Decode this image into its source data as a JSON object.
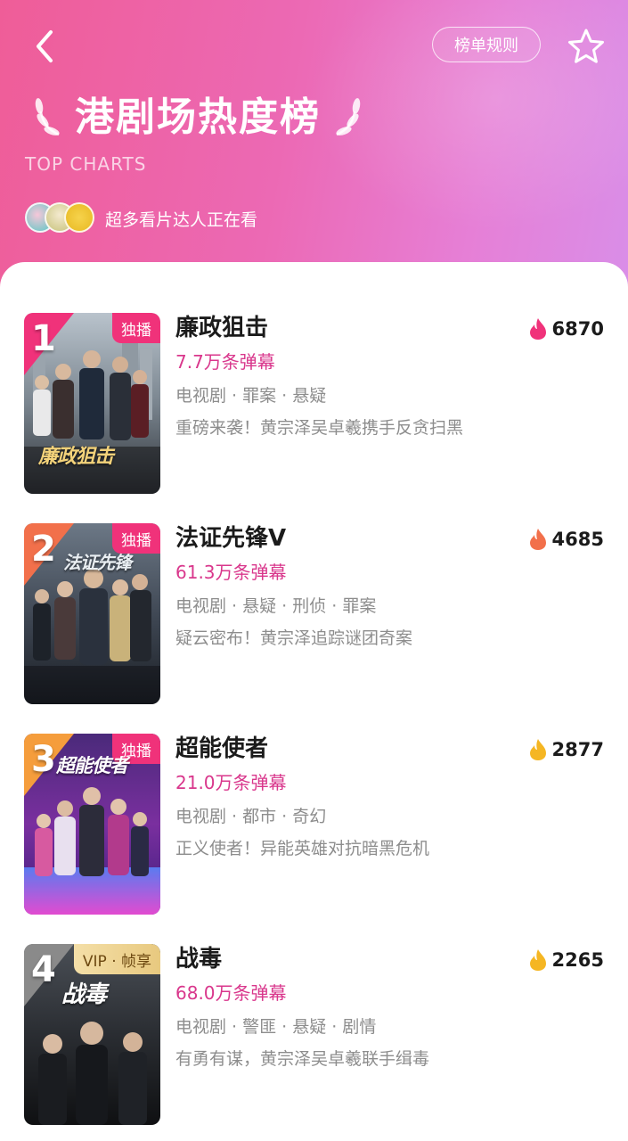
{
  "header": {
    "rules_label": "榜单规则",
    "title": "港剧场热度榜",
    "subtitle": "TOP CHARTS",
    "watching_text": "超多看片达人正在看"
  },
  "colors": {
    "header_gradient_start": "#ef5d98",
    "header_gradient_end": "#d98ee8",
    "danmu_text": "#d9378c",
    "exclusive_tag": "#f0327a",
    "rank1_badge": "#f0327a",
    "rank2_badge": "#f2704b",
    "rank3_badge": "#f59d3c",
    "rank4_badge": "#8a8a8a"
  },
  "items": [
    {
      "rank": "1",
      "tag": "独播",
      "tag_type": "exclusive",
      "poster_text": "廉政狙击",
      "title": "廉政狙击",
      "danmu": "7.7万条弹幕",
      "genres": "电视剧 · 罪案 · 悬疑",
      "desc": "重磅来袭！黄宗泽吴卓羲携手反贪扫黑",
      "heat": "6870",
      "flame_color": "#f0327a"
    },
    {
      "rank": "2",
      "tag": "独播",
      "tag_type": "exclusive",
      "poster_text": "法证先锋",
      "title": "法证先锋Ⅴ",
      "danmu": "61.3万条弹幕",
      "genres": "电视剧 · 悬疑 · 刑侦 · 罪案",
      "desc": "疑云密布！黄宗泽追踪谜团奇案",
      "heat": "4685",
      "flame_color": "#f2704b"
    },
    {
      "rank": "3",
      "tag": "独播",
      "tag_type": "exclusive",
      "poster_text": "超能使者",
      "title": "超能使者",
      "danmu": "21.0万条弹幕",
      "genres": "电视剧 · 都市 · 奇幻",
      "desc": "正义使者！异能英雄对抗暗黑危机",
      "heat": "2877",
      "flame_color": "#f5b623"
    },
    {
      "rank": "4",
      "tag": "VIP · 帧享",
      "tag_type": "vip",
      "poster_text": "战毒",
      "title": "战毒",
      "danmu": "68.0万条弹幕",
      "genres": "电视剧 · 警匪 · 悬疑 · 剧情",
      "desc": "有勇有谋，黄宗泽吴卓羲联手缉毒",
      "heat": "2265",
      "flame_color": "#f5b623"
    }
  ]
}
